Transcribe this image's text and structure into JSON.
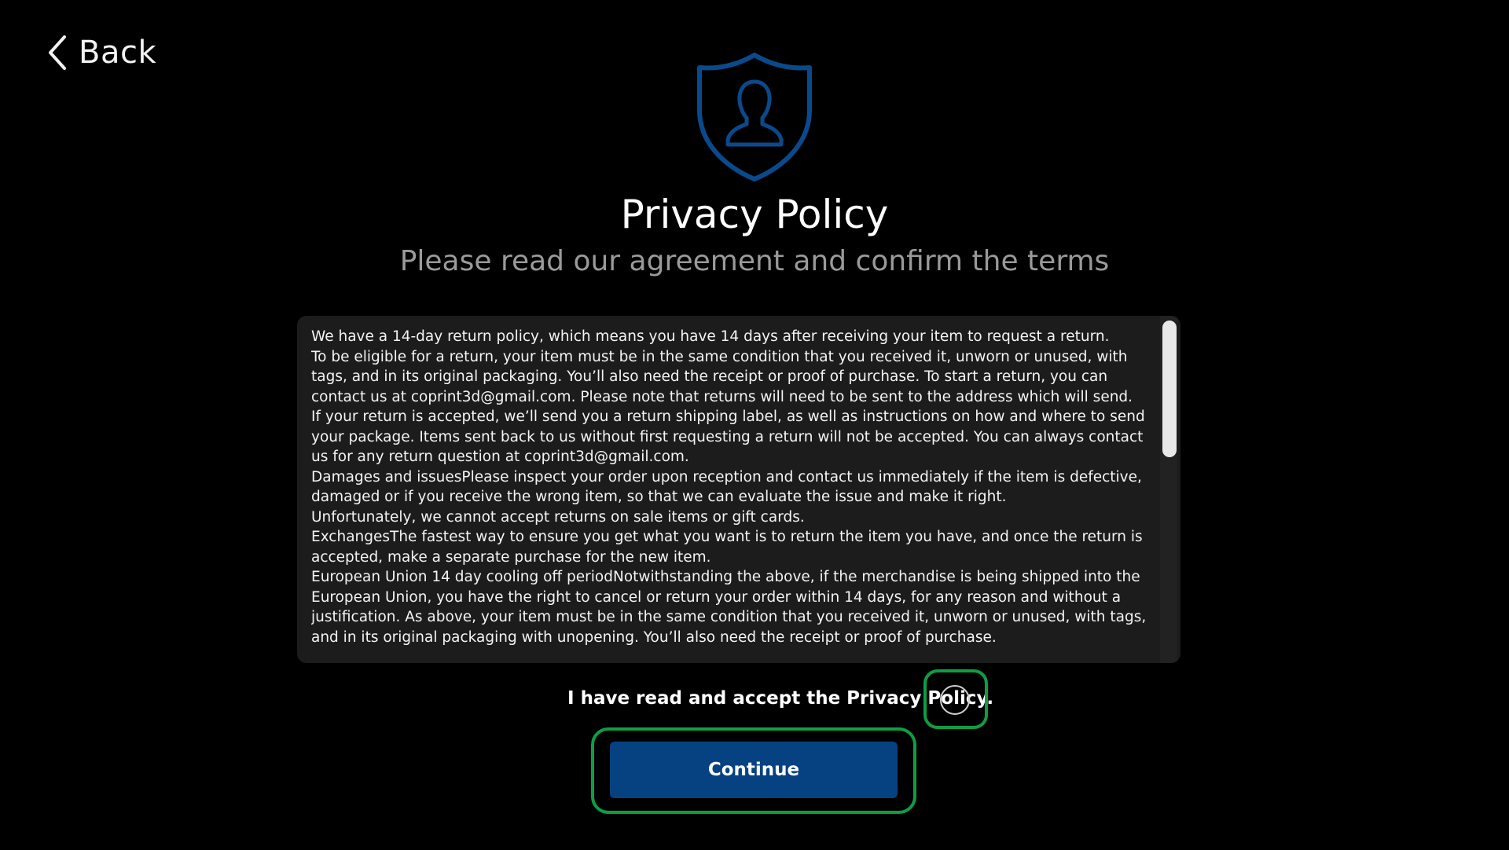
{
  "nav": {
    "back_label": "Back"
  },
  "header": {
    "title": "Privacy Policy",
    "subtitle": "Please read our agreement and confirm the terms"
  },
  "policy": {
    "paragraphs": [
      "We have a 14-day return policy, which means you have 14 days after receiving your item to request a return.",
      "To be eligible for a return, your item must be in the same condition that you received it, unworn or unused, with tags, and in its original packaging. You’ll also need the receipt or proof of purchase. To start a return, you can contact us at coprint3d@gmail.com. Please note that returns will need to be sent to the address which will send.",
      "If your return is accepted, we’ll send you a return shipping label, as well as instructions on how and where to send your package. Items sent back to us without first requesting a return will not be accepted. You can always contact us for any return question at coprint3d@gmail.com.",
      "Damages and issuesPlease inspect your order upon reception and contact us immediately if the item is defective, damaged or if you receive the wrong item, so that we can evaluate the issue and make it right.",
      "Unfortunately, we cannot accept returns on sale items or gift cards.",
      "ExchangesThe fastest way to ensure you get what you want is to return the item you have, and once the return is accepted, make a separate purchase for the new item.",
      "European Union 14 day cooling off periodNotwithstanding the above, if the merchandise is being shipped into the European Union, you have the right to cancel or return your order within 14 days, for any reason and without a justification. As above, your item must be in the same condition that you received it, unworn or unused, with tags, and in its original packaging with unopening. You’ll also need the receipt or proof of purchase."
    ]
  },
  "consent": {
    "label": "I have read and accept the Privacy Policy.",
    "checked": false
  },
  "actions": {
    "continue_label": "Continue"
  },
  "colors": {
    "accent": "#064281",
    "shield": "#0a4a8c",
    "focus_ring": "#0f9d44",
    "background": "#000000",
    "panel": "#1c1c1c"
  },
  "icons": {
    "back": "chevron-left-icon",
    "shield": "shield-user-icon",
    "checkbox": "radio-circle-icon"
  }
}
